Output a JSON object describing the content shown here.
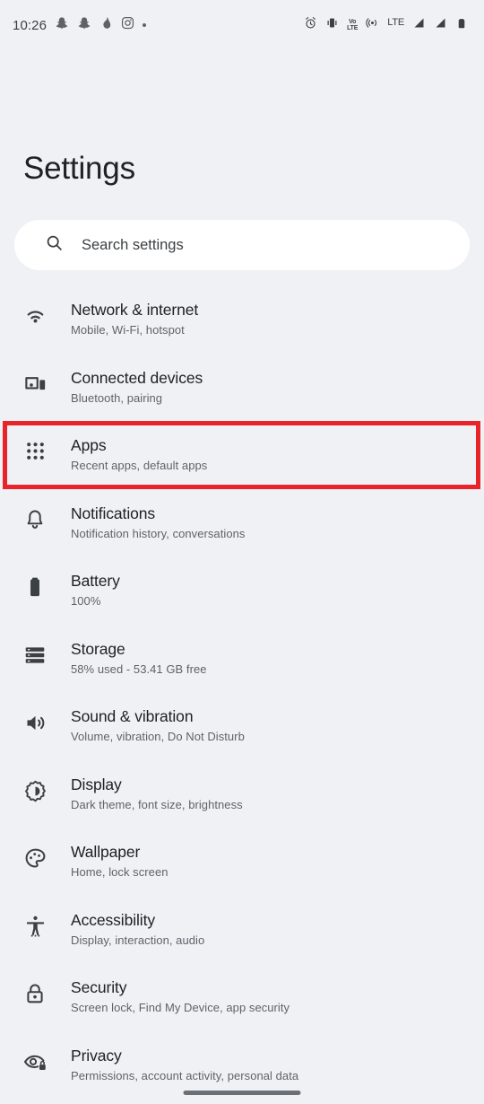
{
  "status_bar": {
    "time": "10:26",
    "left_icons": [
      "snapchat-icon",
      "snapchat-icon",
      "flame-icon",
      "instagram-icon",
      "more-dot-icon"
    ],
    "right_icons": [
      "alarm-icon",
      "vibrate-icon",
      "volte-icon",
      "hotspot-icon",
      "lte-icon",
      "signal-icon",
      "signal-icon",
      "battery-icon"
    ],
    "volte_label_top": "VoLTE",
    "volte_label_line1": "Vo",
    "volte_label_line2": "LTE",
    "network_type": "LTE"
  },
  "header": {
    "title": "Settings"
  },
  "search": {
    "placeholder": "Search settings",
    "icon": "search-icon"
  },
  "highlight": {
    "color": "#e8232a",
    "target": "Apps"
  },
  "colors": {
    "background": "#eff1f5",
    "search_background": "#ffffff",
    "title_text": "#202124",
    "subtitle_text": "#5f6368",
    "highlight": "#e8232a",
    "gesture_bar": "#6b6f76"
  },
  "settings_items": [
    {
      "title": "Network & internet",
      "subtitle": "Mobile, Wi-Fi, hotspot",
      "icon": "wifi-icon"
    },
    {
      "title": "Connected devices",
      "subtitle": "Bluetooth, pairing",
      "icon": "connected-devices-icon"
    },
    {
      "title": "Apps",
      "subtitle": "Recent apps, default apps",
      "icon": "apps-grid-icon"
    },
    {
      "title": "Notifications",
      "subtitle": "Notification history, conversations",
      "icon": "bell-icon"
    },
    {
      "title": "Battery",
      "subtitle": "100%",
      "icon": "battery-icon"
    },
    {
      "title": "Storage",
      "subtitle": "58% used - 53.41 GB free",
      "icon": "storage-icon"
    },
    {
      "title": "Sound & vibration",
      "subtitle": "Volume, vibration, Do Not Disturb",
      "icon": "volume-icon"
    },
    {
      "title": "Display",
      "subtitle": "Dark theme, font size, brightness",
      "icon": "brightness-icon"
    },
    {
      "title": "Wallpaper",
      "subtitle": "Home, lock screen",
      "icon": "palette-icon"
    },
    {
      "title": "Accessibility",
      "subtitle": "Display, interaction, audio",
      "icon": "accessibility-icon"
    },
    {
      "title": "Security",
      "subtitle": "Screen lock, Find My Device, app security",
      "icon": "lock-icon"
    },
    {
      "title": "Privacy",
      "subtitle": "Permissions, account activity, personal data",
      "icon": "eye-lock-icon"
    }
  ],
  "navigation": {
    "gesture_bar": "home-gesture-bar"
  }
}
